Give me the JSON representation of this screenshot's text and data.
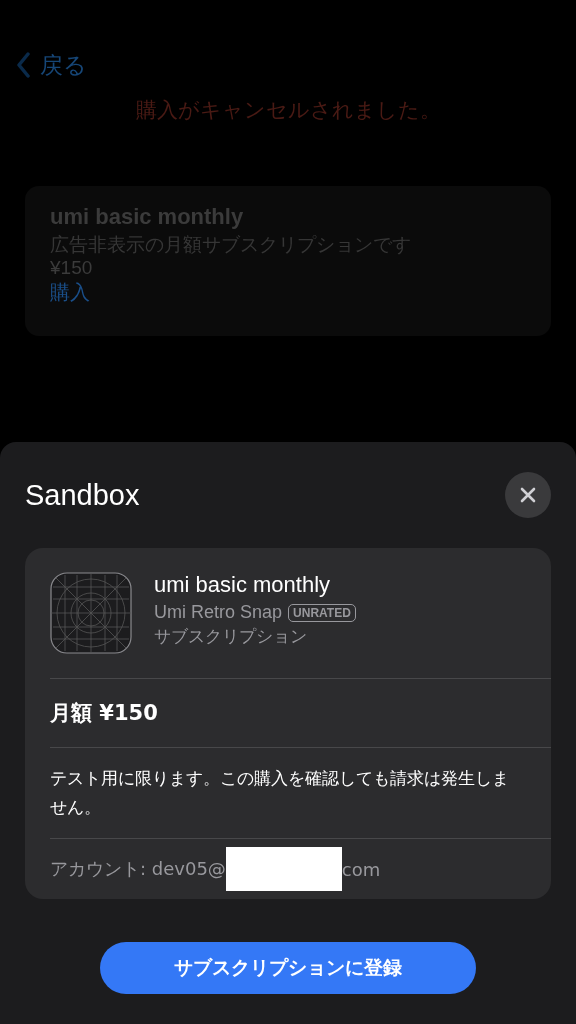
{
  "background": {
    "back": {
      "label": "戻る"
    },
    "message": "購入がキャンセルされました。",
    "product": {
      "title": "umi basic monthly",
      "description": "広告非表示の月額サブスクリプションです",
      "price": "¥150",
      "buy": "購入"
    }
  },
  "sheet": {
    "title": "Sandbox",
    "item": {
      "name": "umi basic monthly",
      "app": "Umi Retro Snap",
      "rating": "UNRATED",
      "type": "サブスクリプション"
    },
    "price": "月額 ¥150",
    "notice": "テスト用に限ります。この購入を確認しても請求は発生しません。",
    "account": {
      "before": "アカウント: dev05@",
      "after": "com"
    },
    "confirm": "サブスクリプションに登録"
  }
}
